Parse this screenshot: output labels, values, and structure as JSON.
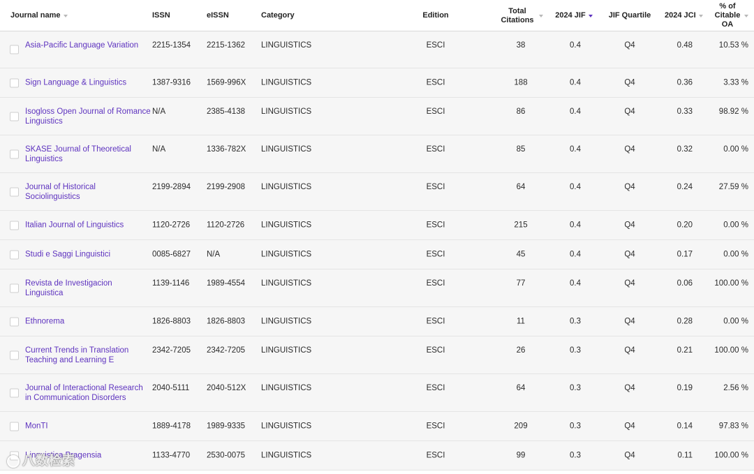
{
  "columns": {
    "journal_name": "Journal name",
    "issn": "ISSN",
    "eissn": "eISSN",
    "category": "Category",
    "edition": "Edition",
    "total_citations": "Total Citations",
    "jif": "2024 JIF",
    "jif_quartile": "JIF Quartile",
    "jci": "2024 JCI",
    "citable_oa": "% of Citable OA"
  },
  "sort": {
    "active_column": "2024 JIF",
    "direction": "descending",
    "accent_color": "#5e33bf"
  },
  "rows": [
    {
      "name": "Asia-Pacific Language Variation",
      "issn": "2215-1354",
      "eissn": "2215-1362",
      "category": "LINGUISTICS",
      "edition": "ESCI",
      "citations": "38",
      "jif": "0.4",
      "quartile": "Q4",
      "jci": "0.48",
      "oa": "10.53 %"
    },
    {
      "name": "Sign Language & Linguistics",
      "issn": "1387-9316",
      "eissn": "1569-996X",
      "category": "LINGUISTICS",
      "edition": "ESCI",
      "citations": "188",
      "jif": "0.4",
      "quartile": "Q4",
      "jci": "0.36",
      "oa": "3.33 %"
    },
    {
      "name": "Isogloss Open Journal of Romance Linguistics",
      "issn": "N/A",
      "eissn": "2385-4138",
      "category": "LINGUISTICS",
      "edition": "ESCI",
      "citations": "86",
      "jif": "0.4",
      "quartile": "Q4",
      "jci": "0.33",
      "oa": "98.92 %"
    },
    {
      "name": "SKASE Journal of Theoretical Linguistics",
      "issn": "N/A",
      "eissn": "1336-782X",
      "category": "LINGUISTICS",
      "edition": "ESCI",
      "citations": "85",
      "jif": "0.4",
      "quartile": "Q4",
      "jci": "0.32",
      "oa": "0.00 %"
    },
    {
      "name": "Journal of Historical Sociolinguistics",
      "issn": "2199-2894",
      "eissn": "2199-2908",
      "category": "LINGUISTICS",
      "edition": "ESCI",
      "citations": "64",
      "jif": "0.4",
      "quartile": "Q4",
      "jci": "0.24",
      "oa": "27.59 %"
    },
    {
      "name": "Italian Journal of Linguistics",
      "issn": "1120-2726",
      "eissn": "1120-2726",
      "category": "LINGUISTICS",
      "edition": "ESCI",
      "citations": "215",
      "jif": "0.4",
      "quartile": "Q4",
      "jci": "0.20",
      "oa": "0.00 %"
    },
    {
      "name": "Studi e Saggi Linguistici",
      "issn": "0085-6827",
      "eissn": "N/A",
      "category": "LINGUISTICS",
      "edition": "ESCI",
      "citations": "45",
      "jif": "0.4",
      "quartile": "Q4",
      "jci": "0.17",
      "oa": "0.00 %"
    },
    {
      "name": "Revista de Investigacion Linguistica",
      "issn": "1139-1146",
      "eissn": "1989-4554",
      "category": "LINGUISTICS",
      "edition": "ESCI",
      "citations": "77",
      "jif": "0.4",
      "quartile": "Q4",
      "jci": "0.06",
      "oa": "100.00 %"
    },
    {
      "name": "Ethnorema",
      "issn": "1826-8803",
      "eissn": "1826-8803",
      "category": "LINGUISTICS",
      "edition": "ESCI",
      "citations": "11",
      "jif": "0.3",
      "quartile": "Q4",
      "jci": "0.28",
      "oa": "0.00 %"
    },
    {
      "name": "Current Trends in Translation Teaching and Learning E",
      "issn": "2342-7205",
      "eissn": "2342-7205",
      "category": "LINGUISTICS",
      "edition": "ESCI",
      "citations": "26",
      "jif": "0.3",
      "quartile": "Q4",
      "jci": "0.21",
      "oa": "100.00 %"
    },
    {
      "name": "Journal of Interactional Research in Communication Disorders",
      "issn": "2040-5111",
      "eissn": "2040-512X",
      "category": "LINGUISTICS",
      "edition": "ESCI",
      "citations": "64",
      "jif": "0.3",
      "quartile": "Q4",
      "jci": "0.19",
      "oa": "2.56 %"
    },
    {
      "name": "MonTI",
      "issn": "1889-4178",
      "eissn": "1989-9335",
      "category": "LINGUISTICS",
      "edition": "ESCI",
      "citations": "209",
      "jif": "0.3",
      "quartile": "Q4",
      "jci": "0.14",
      "oa": "97.83 %"
    },
    {
      "name": "Linguistica Pragensia",
      "issn": "1133-4770",
      "eissn": "2530-0075",
      "category": "LINGUISTICS",
      "edition": "ESCI",
      "citations": "99",
      "jif": "0.3",
      "quartile": "Q4",
      "jci": "0.11",
      "oa": "100.00 %"
    }
  ],
  "watermark": "八数检索"
}
